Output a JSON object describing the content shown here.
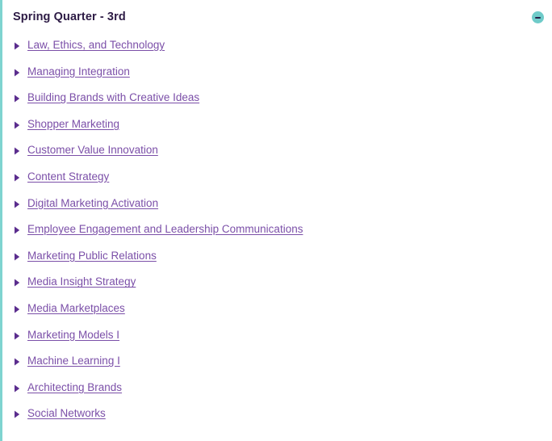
{
  "panel": {
    "title": "Spring Quarter - 3rd",
    "accent_color": "#7fd4d0",
    "link_color": "#7b4fa8",
    "bullet_color": "#5b2d8e",
    "title_color": "#2d1b45",
    "background_color": "#ffffff"
  },
  "collapse_button": {
    "icon": "minus-circle-icon",
    "label": "",
    "fill_color": "#6fcbc9",
    "glyph_color": "#27204a"
  },
  "courses": [
    {
      "label": "Law, Ethics, and Technology",
      "icon": "triangle-right-icon"
    },
    {
      "label": "Managing Integration",
      "icon": "triangle-right-icon"
    },
    {
      "label": "Building Brands with Creative Ideas",
      "icon": "triangle-right-icon"
    },
    {
      "label": "Shopper Marketing",
      "icon": "triangle-right-icon"
    },
    {
      "label": "Customer Value Innovation",
      "icon": "triangle-right-icon"
    },
    {
      "label": "Content Strategy",
      "icon": "triangle-right-icon"
    },
    {
      "label": "Digital Marketing Activation",
      "icon": "triangle-right-icon"
    },
    {
      "label": "Employee Engagement and Leadership Communications",
      "icon": "triangle-right-icon"
    },
    {
      "label": "Marketing Public Relations",
      "icon": "triangle-right-icon"
    },
    {
      "label": "Media Insight Strategy",
      "icon": "triangle-right-icon"
    },
    {
      "label": "Media Marketplaces",
      "icon": "triangle-right-icon"
    },
    {
      "label": "Marketing Models I",
      "icon": "triangle-right-icon"
    },
    {
      "label": "Machine Learning I",
      "icon": "triangle-right-icon"
    },
    {
      "label": "Architecting Brands",
      "icon": "triangle-right-icon"
    },
    {
      "label": "Social Networks",
      "icon": "triangle-right-icon"
    }
  ]
}
